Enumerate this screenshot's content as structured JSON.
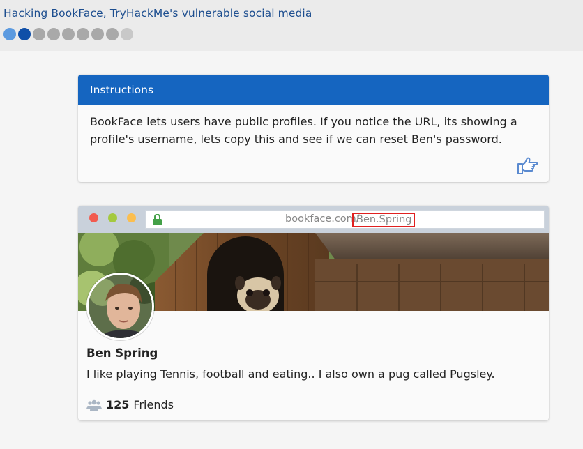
{
  "header": {
    "title": "Hacking BookFace, TryHackMe's vulnerable social media",
    "progress": {
      "total_steps": 9,
      "current_step": 2,
      "dot_colors": [
        "#5b9ae0",
        "#0f4fa8",
        "#a9a9a9",
        "#a9a9a9",
        "#a9a9a9",
        "#a9a9a9",
        "#a9a9a9",
        "#a9a9a9",
        "#c8c8c8"
      ]
    }
  },
  "instructions": {
    "title": "Instructions",
    "body": "BookFace lets users have public profiles. If you notice the URL, its showing a profile's username, lets copy this and see if we can reset Ben's password.",
    "action_icon": "thumbs-up-pointing-icon"
  },
  "browser": {
    "url_domain": "bookface.com/",
    "url_path": "Ben.Spring",
    "lock_icon": "lock-icon"
  },
  "profile": {
    "name": "Ben Spring",
    "bio": "I like playing Tennis, football and eating.. I also own a pug called Pugsley.",
    "friends_count": "125",
    "friends_label": "Friends",
    "friends_icon": "users-icon"
  },
  "colors": {
    "header_bg": "#ebebeb",
    "title_text": "#1d4e8f",
    "card_header": "#1565c0",
    "url_highlight": "#e02020"
  }
}
